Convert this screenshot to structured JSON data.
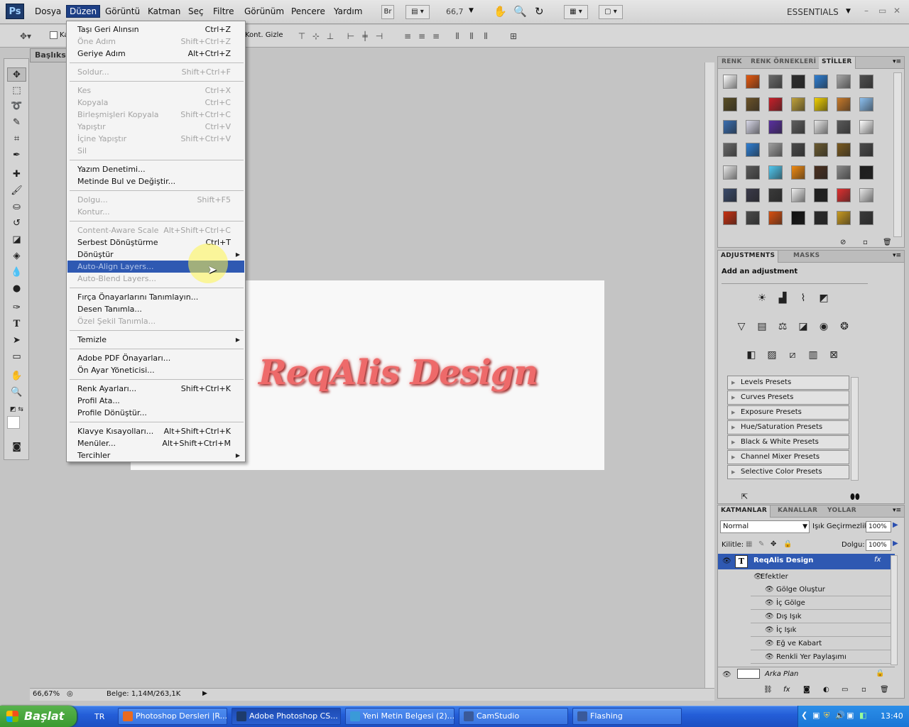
{
  "menubar": {
    "logo": "Ps",
    "items": [
      "Dosya",
      "Düzen",
      "Görüntü",
      "Katman",
      "Seç",
      "Filtre",
      "Görünüm",
      "Pencere",
      "Yardım"
    ],
    "bridge_label": "Br",
    "zoom_value": "66,7",
    "workspace": "ESSENTIALS",
    "window_controls": [
      "–",
      "▭",
      "✕"
    ]
  },
  "options_bar": {
    "label_partial": "Ka",
    "show_transform_partial": "Kont. Gizle"
  },
  "document": {
    "tab_title": "Başlıksı",
    "canvas_text": "ReqAlis Design"
  },
  "status": {
    "zoom": "66,67%",
    "doc_size": "Belge: 1,14M/263,1K"
  },
  "edit_menu": {
    "groups": [
      [
        {
          "label": "Taşı Geri Alınsın",
          "shortcut": "Ctrl+Z",
          "disabled": false
        },
        {
          "label": "Öne Adım",
          "shortcut": "Shift+Ctrl+Z",
          "disabled": true
        },
        {
          "label": "Geriye Adım",
          "shortcut": "Alt+Ctrl+Z",
          "disabled": false
        }
      ],
      [
        {
          "label": "Soldur...",
          "shortcut": "Shift+Ctrl+F",
          "disabled": true
        }
      ],
      [
        {
          "label": "Kes",
          "shortcut": "Ctrl+X",
          "disabled": true
        },
        {
          "label": "Kopyala",
          "shortcut": "Ctrl+C",
          "disabled": true
        },
        {
          "label": "Birleşmişleri Kopyala",
          "shortcut": "Shift+Ctrl+C",
          "disabled": true
        },
        {
          "label": "Yapıştır",
          "shortcut": "Ctrl+V",
          "disabled": true
        },
        {
          "label": "İçine Yapıştır",
          "shortcut": "Shift+Ctrl+V",
          "disabled": true
        },
        {
          "label": "Sil",
          "shortcut": "",
          "disabled": true
        }
      ],
      [
        {
          "label": "Yazım Denetimi...",
          "shortcut": "",
          "disabled": false
        },
        {
          "label": "Metinde Bul ve Değiştir...",
          "shortcut": "",
          "disabled": false
        }
      ],
      [
        {
          "label": "Dolgu...",
          "shortcut": "Shift+F5",
          "disabled": true
        },
        {
          "label": "Kontur...",
          "shortcut": "",
          "disabled": true
        }
      ],
      [
        {
          "label": "Content-Aware Scale",
          "shortcut": "Alt+Shift+Ctrl+C",
          "disabled": true
        },
        {
          "label": "Serbest Dönüştürme",
          "shortcut": "Ctrl+T",
          "disabled": false
        },
        {
          "label": "Dönüştür",
          "shortcut": "",
          "disabled": false,
          "submenu": true
        },
        {
          "label": "Auto-Align Layers...",
          "shortcut": "",
          "disabled": true,
          "highlighted": true
        },
        {
          "label": "Auto-Blend Layers...",
          "shortcut": "",
          "disabled": true
        }
      ],
      [
        {
          "label": "Fırça Önayarlarını Tanımlayın...",
          "shortcut": "",
          "disabled": false
        },
        {
          "label": "Desen Tanımla...",
          "shortcut": "",
          "disabled": false
        },
        {
          "label": "Özel Şekil Tanımla...",
          "shortcut": "",
          "disabled": true
        }
      ],
      [
        {
          "label": "Temizle",
          "shortcut": "",
          "disabled": false,
          "submenu": true
        }
      ],
      [
        {
          "label": "Adobe PDF Önayarları...",
          "shortcut": "",
          "disabled": false
        },
        {
          "label": "Ön Ayar Yöneticisi...",
          "shortcut": "",
          "disabled": false
        }
      ],
      [
        {
          "label": "Renk Ayarları...",
          "shortcut": "Shift+Ctrl+K",
          "disabled": false
        },
        {
          "label": "Profil Ata...",
          "shortcut": "",
          "disabled": false
        },
        {
          "label": "Profile Dönüştür...",
          "shortcut": "",
          "disabled": false
        }
      ],
      [
        {
          "label": "Klavye Kısayolları...",
          "shortcut": "Alt+Shift+Ctrl+K",
          "disabled": false
        },
        {
          "label": "Menüler...",
          "shortcut": "Alt+Shift+Ctrl+M",
          "disabled": false
        },
        {
          "label": "Tercihler",
          "shortcut": "",
          "disabled": false,
          "submenu": true
        }
      ]
    ]
  },
  "styles_panel": {
    "tabs": [
      "RENK",
      "RENK ÖRNEKLERİ",
      "STİLLER"
    ],
    "active_tab": "STİLLER",
    "swatch_colors": [
      "#ffffff",
      "#e65a10",
      "#6a6a6a",
      "#2e2e2e",
      "#2f7fd3",
      "#a8a8a8",
      "#4f4f4f",
      "#5a4e24",
      "#6c5328",
      "#c8202a",
      "#c0a23a",
      "#f0d000",
      "#c87a2a",
      "#8cc0f0",
      "#3a6eb0",
      "#d8d8e8",
      "#5a30a0",
      "#5e5e5e",
      "#e8e8e8",
      "#5a5a5a",
      "#ffffff",
      "#6a6a6a",
      "#2f7fd3",
      "#a0a0a0",
      "#4a4a4a",
      "#6a5a30",
      "#7a5a20",
      "#4a4a4a",
      "#e8e8e8",
      "#5a5a5a",
      "#50c8f0",
      "#f08a10",
      "#4a3020",
      "#8a8a8a",
      "#1e1e1e",
      "#3a4a6a",
      "#3a3a4a",
      "#3a3a3a",
      "#f0f0f0",
      "#202020",
      "#e03030",
      "#e8e8e8",
      "#c83010",
      "#4a4a4a",
      "#d85010",
      "#101010",
      "#2a2a2a",
      "#c89a20",
      "#3a3a3a"
    ]
  },
  "adjustments_panel": {
    "tabs": [
      "ADJUSTMENTS",
      "MASKS"
    ],
    "title": "Add an adjustment",
    "presets": [
      "Levels Presets",
      "Curves Presets",
      "Exposure Presets",
      "Hue/Saturation Presets",
      "Black & White Presets",
      "Channel Mixer Presets",
      "Selective Color Presets"
    ]
  },
  "layers_panel": {
    "tabs": [
      "KATMANLAR",
      "KANALLAR",
      "YOLLAR"
    ],
    "blend_mode": "Normal",
    "opacity_label": "Işık Geçirmezlik:",
    "opacity_value": "100%",
    "lock_label": "Kilitle:",
    "fill_label": "Dolgu:",
    "fill_value": "100%",
    "text_layer": "ReqAlis Design",
    "fx_badge": "fx",
    "effects_label": "Efektler",
    "effects": [
      "Gölge Oluştur",
      "İç Gölge",
      "Dış Işık",
      "İç Işık",
      "Eğ ve Kabart",
      "Renkli Yer Paylaşımı"
    ],
    "background_layer": "Arka Plan"
  },
  "taskbar": {
    "start": "Başlat",
    "lang": "TR",
    "tasks": [
      "Photoshop Dersleri |R...",
      "Adobe Photoshop CS...",
      "Yeni Metin Belgesi (2)...",
      "CamStudio",
      "Flashing"
    ],
    "task_colors": [
      "#e86a20",
      "#1d3b6c",
      "#3a9ad8",
      "#3a5a9a",
      "#3a5a9a"
    ],
    "clock": "13:40"
  }
}
